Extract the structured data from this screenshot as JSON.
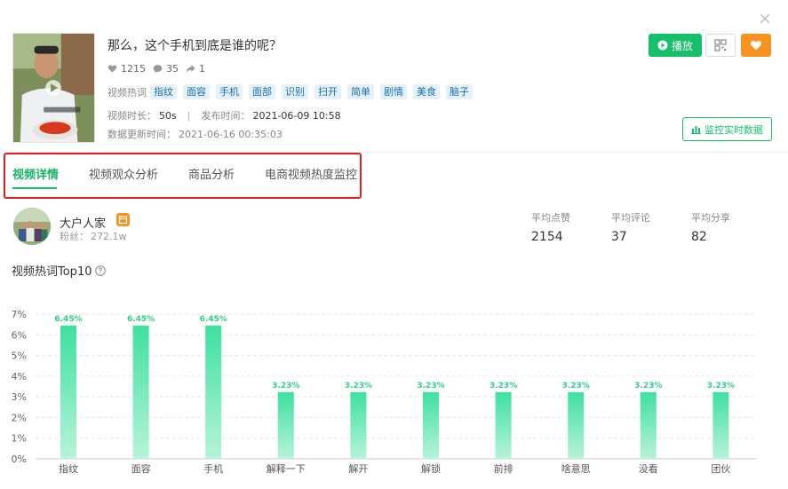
{
  "video": {
    "title": "那么，这个手机到底是谁的呢？",
    "likes": "1215",
    "comments": "35",
    "shares": "1",
    "tags_label": "视频热词",
    "tags": [
      "指纹",
      "面容",
      "手机",
      "面部",
      "识别",
      "扫开",
      "简单",
      "剧情",
      "美食",
      "脑子"
    ],
    "duration_label": "视频时长：",
    "duration": "50s",
    "sep": "|",
    "publish_label": "发布时间：",
    "publish_time": "2021-06-09 10:58",
    "update_label": "数据更新时间：",
    "update_time": "2021-06-16 00:35:03"
  },
  "buttons": {
    "play": "播放",
    "monitor": "监控实时数据"
  },
  "tabs": [
    {
      "label": "视频详情",
      "active": true
    },
    {
      "label": "视频观众分析",
      "active": false
    },
    {
      "label": "商品分析",
      "active": false
    },
    {
      "label": "电商视频热度监控",
      "active": false
    }
  ],
  "author": {
    "name": "大户人家",
    "fans_label": "粉丝：",
    "fans": "272.1w"
  },
  "averages": [
    {
      "label": "平均点赞",
      "value": "2154"
    },
    {
      "label": "平均评论",
      "value": "37"
    },
    {
      "label": "平均分享",
      "value": "82"
    }
  ],
  "section_title": "视频热词Top10",
  "icons": {
    "close": "close-icon",
    "like": "heart-icon",
    "comment": "comment-icon",
    "share": "share-icon",
    "play": "play-icon",
    "qr": "qr-code-icon",
    "fav": "heart-icon",
    "monitor": "bar-chart-icon",
    "help": "question-circle-icon"
  },
  "colors": {
    "brand_green": "#16c06a",
    "tag_bg": "#e6f2fb",
    "tag_text": "#1a6fb0",
    "orange": "#f7931e",
    "highlight_red": "#e02020",
    "bar_top": "#3ee0a0",
    "bar_bottom": "#b8f3da"
  },
  "chart_data": {
    "type": "bar",
    "categories": [
      "指纹",
      "面容",
      "手机",
      "解释一下",
      "解开",
      "解锁",
      "前排",
      "啥意思",
      "没看",
      "团伙"
    ],
    "values": [
      6.45,
      6.45,
      6.45,
      3.23,
      3.23,
      3.23,
      3.23,
      3.23,
      3.23,
      3.23
    ],
    "value_labels": [
      "6.45%",
      "6.45%",
      "6.45%",
      "3.23%",
      "3.23%",
      "3.23%",
      "3.23%",
      "3.23%",
      "3.23%",
      "3.23%"
    ],
    "y_ticks": [
      "0%",
      "1%",
      "2%",
      "3%",
      "4%",
      "5%",
      "6%",
      "7%"
    ],
    "ylim": [
      0,
      7
    ],
    "grid": true
  }
}
